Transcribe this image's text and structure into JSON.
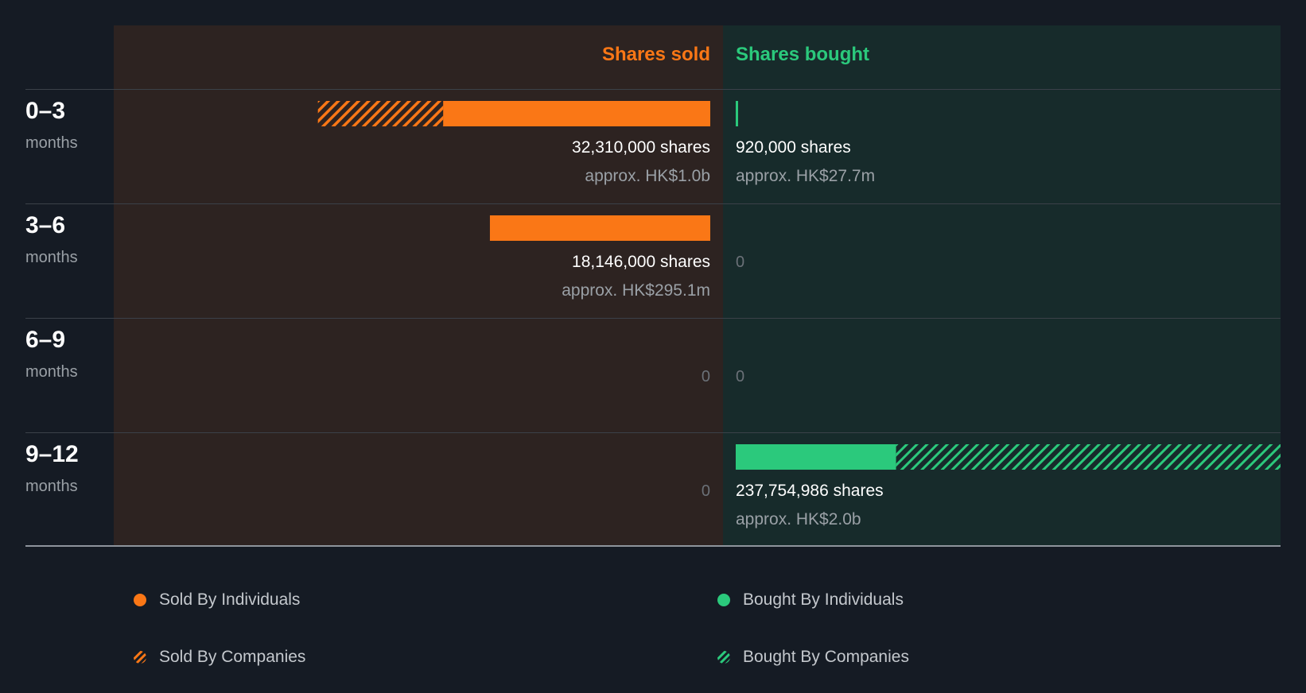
{
  "colors": {
    "sold": "#fa7716",
    "bought": "#2bc97c"
  },
  "headers": {
    "sold": "Shares sold",
    "bought": "Shares bought"
  },
  "rows": [
    {
      "period": "0–3",
      "unit": "months",
      "sold": {
        "shares_label": "32,310,000 shares",
        "value_label": "approx. HK$1.0b",
        "zero_label": ""
      },
      "bought": {
        "shares_label": "920,000 shares",
        "value_label": "approx. HK$27.7m",
        "zero_label": ""
      }
    },
    {
      "period": "3–6",
      "unit": "months",
      "sold": {
        "shares_label": "18,146,000 shares",
        "value_label": "approx. HK$295.1m",
        "zero_label": ""
      },
      "bought": {
        "shares_label": "",
        "value_label": "",
        "zero_label": "0"
      }
    },
    {
      "period": "6–9",
      "unit": "months",
      "sold": {
        "shares_label": "",
        "value_label": "",
        "zero_label": "0"
      },
      "bought": {
        "shares_label": "",
        "value_label": "",
        "zero_label": "0"
      }
    },
    {
      "period": "9–12",
      "unit": "months",
      "sold": {
        "shares_label": "",
        "value_label": "",
        "zero_label": "0"
      },
      "bought": {
        "shares_label": "237,754,986 shares",
        "value_label": "approx. HK$2.0b",
        "zero_label": ""
      }
    }
  ],
  "legend": {
    "sold_individuals": "Sold By Individuals",
    "sold_companies": "Sold By Companies",
    "bought_individuals": "Bought By Individuals",
    "bought_companies": "Bought By Companies"
  },
  "chart_data": {
    "type": "bar",
    "orientation": "horizontal-diverging",
    "categories": [
      "0–3 months",
      "3–6 months",
      "6–9 months",
      "9–12 months"
    ],
    "series": [
      {
        "name": "Sold By Individuals",
        "side": "sold",
        "pattern": "solid",
        "values": [
          22000000,
          18146000,
          0,
          0
        ]
      },
      {
        "name": "Sold By Companies",
        "side": "sold",
        "pattern": "hatched",
        "values": [
          10310000,
          0,
          0,
          0
        ]
      },
      {
        "name": "Bought By Individuals",
        "side": "bought",
        "pattern": "solid",
        "values": [
          920000,
          0,
          0,
          70000000
        ]
      },
      {
        "name": "Bought By Companies",
        "side": "bought",
        "pattern": "hatched",
        "values": [
          0,
          0,
          0,
          167754986
        ]
      }
    ],
    "totals_shares": {
      "sold": [
        32310000,
        18146000,
        0,
        0
      ],
      "bought": [
        920000,
        0,
        0,
        237754986
      ]
    },
    "scale_max_shares": 237754986,
    "legend_position": "bottom"
  }
}
